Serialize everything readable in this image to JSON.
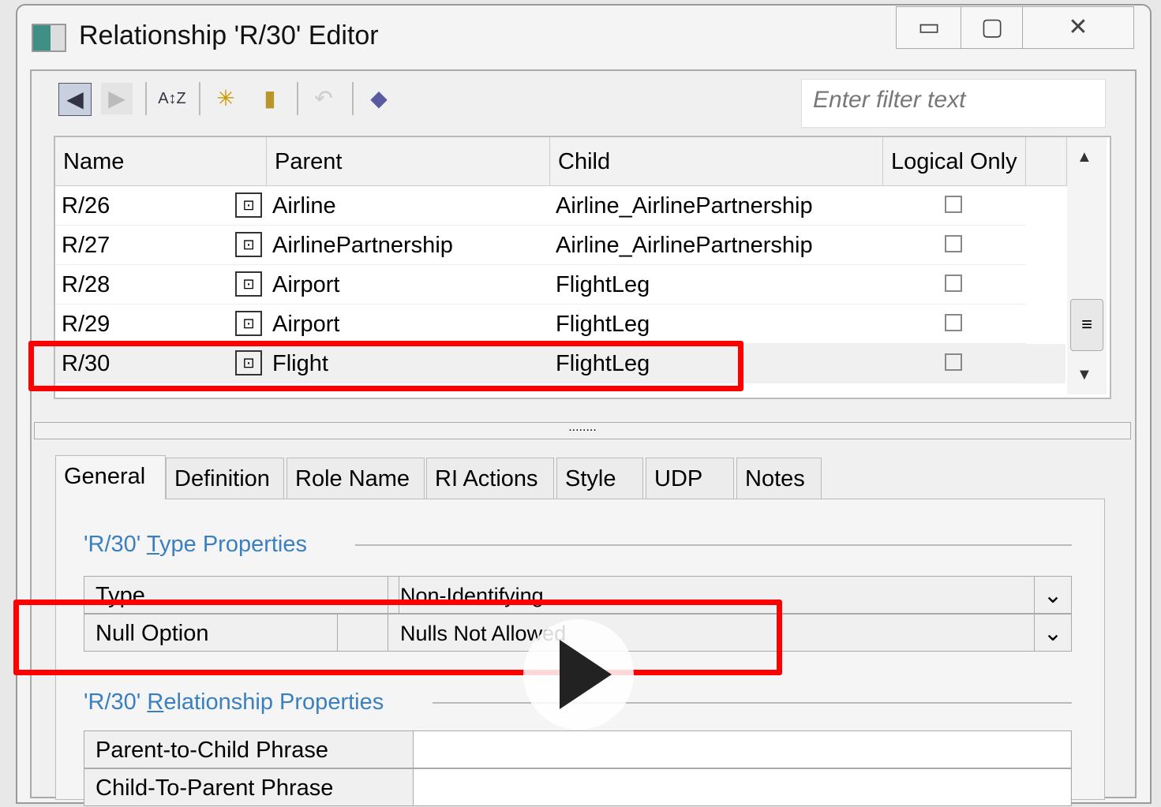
{
  "window": {
    "title": "Relationship 'R/30' Editor",
    "minimize": "▭",
    "maximize": "▢",
    "close": "✕"
  },
  "toolbar": {
    "filter_placeholder": "Enter filter text",
    "icons": [
      "previous-icon",
      "next-icon",
      "sort-icon",
      "new-icon",
      "delete-icon",
      "undo-icon",
      "properties-icon"
    ]
  },
  "grid": {
    "columns": [
      "Name",
      "Parent",
      "Child",
      "Logical Only"
    ],
    "rows": [
      {
        "name": "R/26",
        "parent": "Airline",
        "child": "Airline_AirlinePartnership",
        "logical_only": false
      },
      {
        "name": "R/27",
        "parent": "AirlinePartnership",
        "child": "Airline_AirlinePartnership",
        "logical_only": false
      },
      {
        "name": "R/28",
        "parent": "Airport",
        "child": "FlightLeg",
        "logical_only": false
      },
      {
        "name": "R/29",
        "parent": "Airport",
        "child": "FlightLeg",
        "logical_only": false
      },
      {
        "name": "R/30",
        "parent": "Flight",
        "child": "FlightLeg",
        "logical_only": false,
        "selected": true
      }
    ]
  },
  "splitter": "........",
  "tabs": [
    "General",
    "Definition",
    "Role Name",
    "RI Actions",
    "Style",
    "UDP",
    "Notes"
  ],
  "active_tab": "General",
  "type_section": {
    "title_prefix": "'R/30' ",
    "title_accel": "T",
    "title_rest": "ype Properties",
    "props": [
      {
        "label": "Type",
        "value": "Non-Identifying"
      },
      {
        "label": "Null Option",
        "value": "Nulls Not Allowed"
      }
    ]
  },
  "rel_section": {
    "title_prefix": "'R/30' ",
    "title_accel": "R",
    "title_rest": "elationship Properties",
    "props": [
      {
        "label": "Parent-to-Child Phrase",
        "value": ""
      },
      {
        "label": "Child-To-Parent Phrase",
        "value": ""
      }
    ]
  },
  "colors": {
    "highlight": "#ff0000",
    "section_title": "#3a7fbf"
  }
}
